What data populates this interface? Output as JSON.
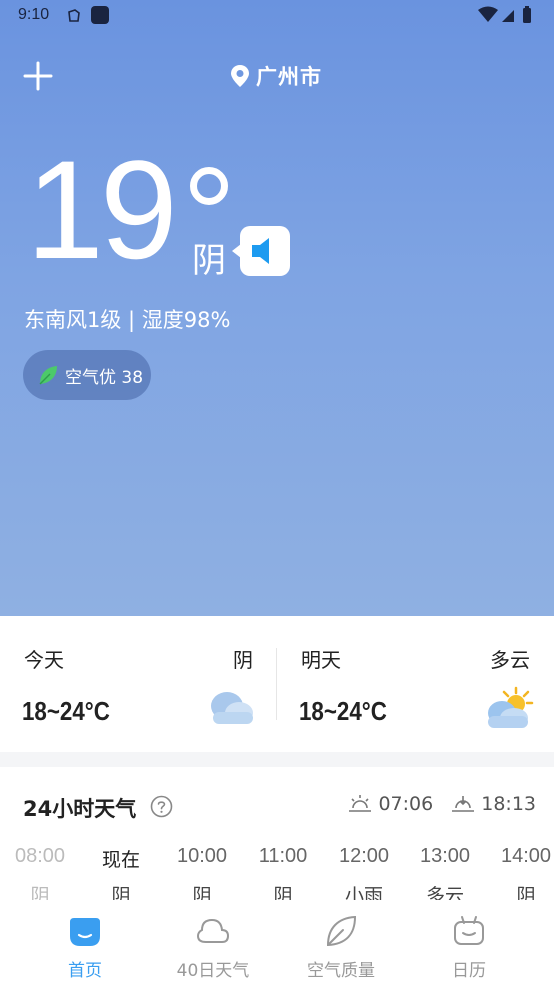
{
  "status_bar": {
    "time": "9:10"
  },
  "header": {
    "city": "广州市",
    "add_icon": "plus-icon",
    "location_icon": "location-pin-icon"
  },
  "current": {
    "temperature": "19",
    "condition": "阴",
    "wind_humidity": "东南风1级 | 湿度98%",
    "aqi_label": "空气优 38",
    "voice_icon": "speaker-icon"
  },
  "daily": [
    {
      "label": "今天",
      "condition": "阴",
      "range": "18~24°C",
      "icon": "cloudy-icon"
    },
    {
      "label": "明天",
      "condition": "多云",
      "range": "18~24°C",
      "icon": "partly-cloudy-icon"
    }
  ],
  "hourly": {
    "title": "24小时天气",
    "sunrise": "07:06",
    "sunset": "18:13",
    "hours": [
      {
        "time": "08:00",
        "cond": "阴",
        "past": true
      },
      {
        "time": "现在",
        "cond": "阴",
        "now": true
      },
      {
        "time": "10:00",
        "cond": "阴"
      },
      {
        "time": "11:00",
        "cond": "阴"
      },
      {
        "time": "12:00",
        "cond": "小雨"
      },
      {
        "time": "13:00",
        "cond": "多云"
      },
      {
        "time": "14:00",
        "cond": "阴"
      }
    ]
  },
  "nav": [
    {
      "label": "首页",
      "icon": "home-icon",
      "active": true
    },
    {
      "label": "40日天气",
      "icon": "forecast-40-icon"
    },
    {
      "label": "空气质量",
      "icon": "leaf-icon"
    },
    {
      "label": "日历",
      "icon": "calendar-icon"
    }
  ],
  "colors": {
    "hero_top": "#6a93df",
    "hero_bottom": "#8fb0e2",
    "accent": "#3a9ef0",
    "aqi_leaf": "#4cc96a"
  }
}
